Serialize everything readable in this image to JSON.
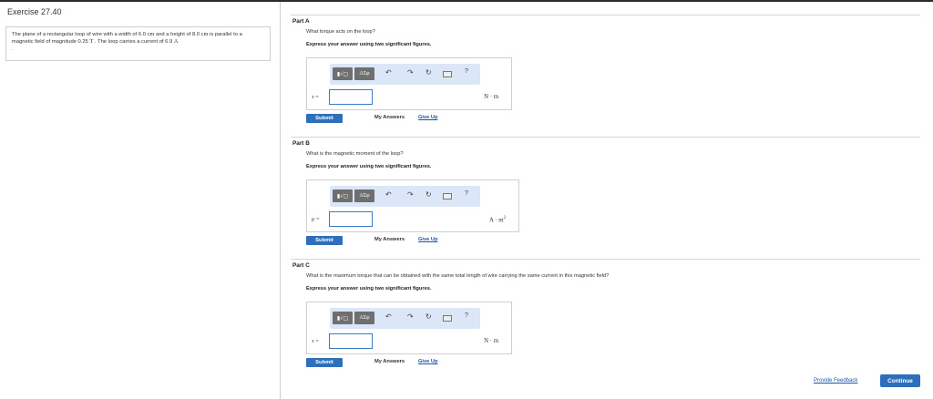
{
  "exercise": {
    "title": "Exercise 27.40",
    "problem_parts": [
      "The plane of a rectangular loop of wire with a width of 6.0 ",
      "cm",
      " and a height of 8.0 ",
      "cm",
      " is parallel to a magnetic field of magnitude 0.25 ",
      "T",
      " . The loop carries a current of 6.9 ",
      "A",
      "."
    ]
  },
  "toolbar": {
    "templates_label": "▮√▢",
    "greek_label": "ΑΣφ",
    "undo_icon": "↶",
    "redo_icon": "↷",
    "reset_icon": "↻",
    "help_label": "?"
  },
  "parts": [
    {
      "label": "Part A",
      "question": "What torque acts on the loop?",
      "instruction": "Express your answer using two significant figures.",
      "variable": "τ =",
      "answer_value": "",
      "unit": "N · m",
      "submit_label": "Submit",
      "my_answers_label": "My Answers",
      "give_up_label": "Give Up"
    },
    {
      "label": "Part B",
      "question": "What is the magnetic moment of the loop?",
      "instruction": "Express your answer using two significant figures.",
      "variable": "μ =",
      "answer_value": "",
      "unit": "A · m",
      "unit_sup": "2",
      "submit_label": "Submit",
      "my_answers_label": "My Answers",
      "give_up_label": "Give Up"
    },
    {
      "label": "Part C",
      "question": "What is the maximum torque that can be obtained with the same total length of wire carrying the same current in this magnetic field?",
      "instruction": "Express your answer using two significant figures.",
      "variable": "τ =",
      "answer_value": "",
      "unit": "N · m",
      "submit_label": "Submit",
      "my_answers_label": "My Answers",
      "give_up_label": "Give Up"
    }
  ],
  "footer": {
    "feedback_label": "Provide Feedback",
    "continue_label": "Continue"
  },
  "colors": {
    "accent": "#2d6fba",
    "link": "#1d56a3",
    "toolbar_bg": "#dbe7f6"
  }
}
